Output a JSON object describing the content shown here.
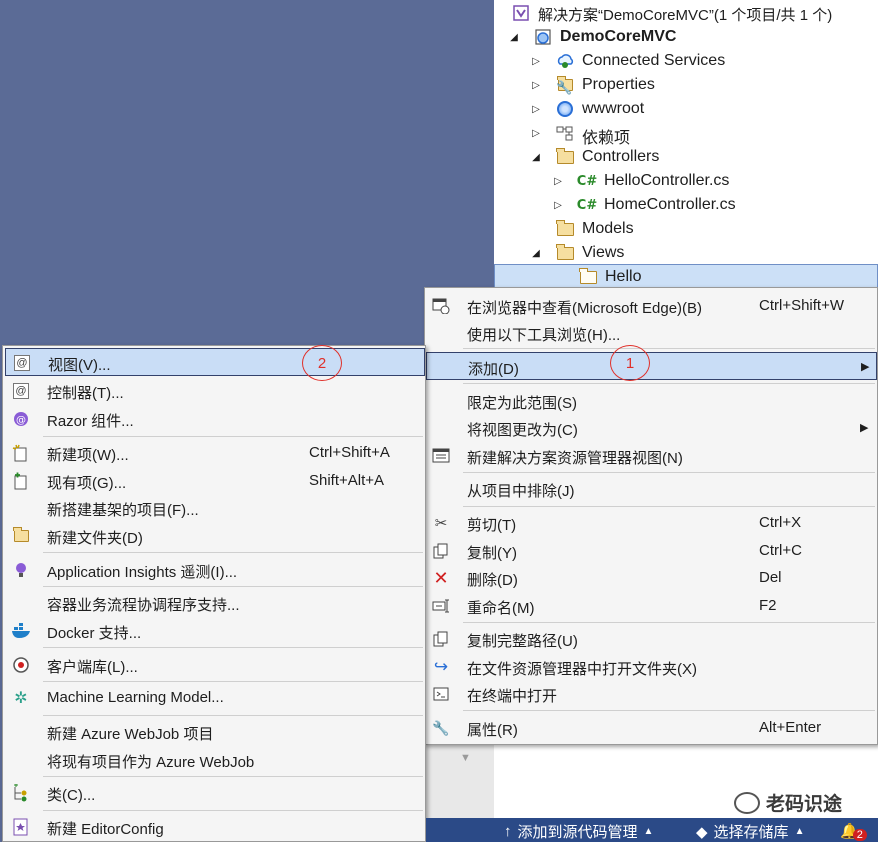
{
  "solution_explorer": {
    "solution_label": "解决方案“DemoCoreMVC”(1 个项目/共 1 个)",
    "project_label": "DemoCoreMVC",
    "nodes": [
      {
        "label": "Connected Services"
      },
      {
        "label": "Properties"
      },
      {
        "label": "wwwroot"
      },
      {
        "label": "依赖项"
      },
      {
        "label": "Controllers"
      },
      {
        "label": "HelloController.cs"
      },
      {
        "label": "HomeController.cs"
      },
      {
        "label": "Models"
      },
      {
        "label": "Views"
      },
      {
        "label": "Hello"
      }
    ]
  },
  "context_menu": {
    "items": [
      {
        "label": "在浏览器中查看(Microsoft Edge)(B)",
        "shortcut": "Ctrl+Shift+W"
      },
      {
        "label": "使用以下工具浏览(H)...",
        "shortcut": ""
      },
      {
        "label": "添加(D)",
        "shortcut": ""
      },
      {
        "label": "限定为此范围(S)",
        "shortcut": ""
      },
      {
        "label": "将视图更改为(C)",
        "shortcut": ""
      },
      {
        "label": "新建解决方案资源管理器视图(N)",
        "shortcut": ""
      },
      {
        "label": "从项目中排除(J)",
        "shortcut": ""
      },
      {
        "label": "剪切(T)",
        "shortcut": "Ctrl+X"
      },
      {
        "label": "复制(Y)",
        "shortcut": "Ctrl+C"
      },
      {
        "label": "删除(D)",
        "shortcut": "Del"
      },
      {
        "label": "重命名(M)",
        "shortcut": "F2"
      },
      {
        "label": "复制完整路径(U)",
        "shortcut": ""
      },
      {
        "label": "在文件资源管理器中打开文件夹(X)",
        "shortcut": ""
      },
      {
        "label": "在终端中打开",
        "shortcut": ""
      },
      {
        "label": "属性(R)",
        "shortcut": "Alt+Enter"
      }
    ],
    "marker": "1"
  },
  "add_submenu": {
    "items": [
      {
        "label": "视图(V)...",
        "shortcut": ""
      },
      {
        "label": "控制器(T)...",
        "shortcut": ""
      },
      {
        "label": "Razor 组件...",
        "shortcut": ""
      },
      {
        "label": "新建项(W)...",
        "shortcut": "Ctrl+Shift+A"
      },
      {
        "label": "现有项(G)...",
        "shortcut": "Shift+Alt+A"
      },
      {
        "label": "新搭建基架的项目(F)...",
        "shortcut": ""
      },
      {
        "label": "新建文件夹(D)",
        "shortcut": ""
      },
      {
        "label": "Application Insights 遥测(I)...",
        "shortcut": ""
      },
      {
        "label": "容器业务流程协调程序支持...",
        "shortcut": ""
      },
      {
        "label": "Docker 支持...",
        "shortcut": ""
      },
      {
        "label": "客户端库(L)...",
        "shortcut": ""
      },
      {
        "label": "Machine Learning Model...",
        "shortcut": ""
      },
      {
        "label": "新建 Azure WebJob 项目",
        "shortcut": ""
      },
      {
        "label": "将现有项目作为 Azure WebJob",
        "shortcut": ""
      },
      {
        "label": "类(C)...",
        "shortcut": ""
      },
      {
        "label": "新建 EditorConfig",
        "shortcut": ""
      }
    ],
    "marker": "2"
  },
  "status_bar": {
    "add_to_source_control": "添加到源代码管理",
    "select_repository": "选择存储库",
    "notification_count": "2"
  },
  "watermark": "老码识途"
}
